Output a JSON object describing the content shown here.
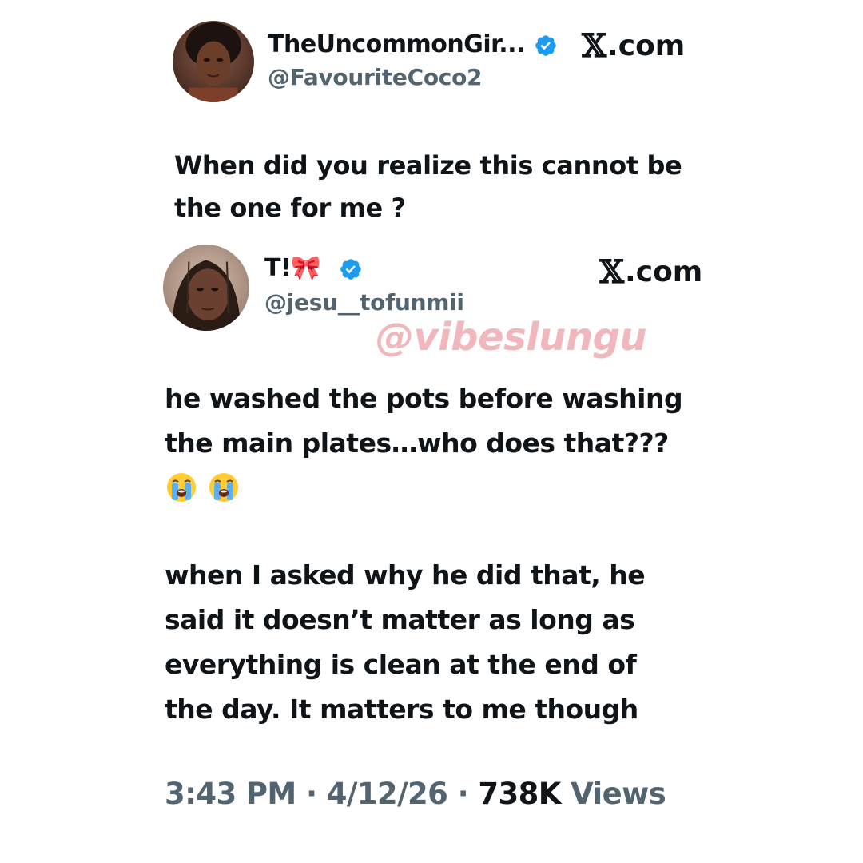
{
  "quoted_tweet": {
    "display_name": "TheUncommonGir...",
    "handle": "@FavouriteCoco2",
    "site_label": "X.com",
    "text_lines": [
      "When did you realize this cannot be",
      "the one for me ?"
    ]
  },
  "main_tweet": {
    "display_name": "T!🎀",
    "handle": "@jesu__tofunmii",
    "site_label": "X.com",
    "paragraph_1_lines": [
      "he washed the pots before washing",
      "the main plates…who does that???"
    ],
    "emojis": [
      "loudly-crying-face",
      "loudly-crying-face"
    ],
    "paragraph_2_lines": [
      "when I asked why he did that, he",
      "said it doesn’t matter as long as",
      "everything is clean at the end of",
      "the day. It matters to me though"
    ]
  },
  "watermark": "@vibeslungu",
  "meta": {
    "time": "3:43 PM",
    "separator": "·",
    "date": "4/12/26",
    "views_count": "738K",
    "views_label": "Views"
  },
  "colors": {
    "primary_text": "#0f1419",
    "secondary_text": "#536471",
    "verified_blue": "#1d9bf0",
    "watermark_pink": "#f0b8bc",
    "background": "#ffffff"
  },
  "icons": {
    "verified": "verified-badge-icon",
    "emoji": "loudly-crying-face-emoji"
  }
}
